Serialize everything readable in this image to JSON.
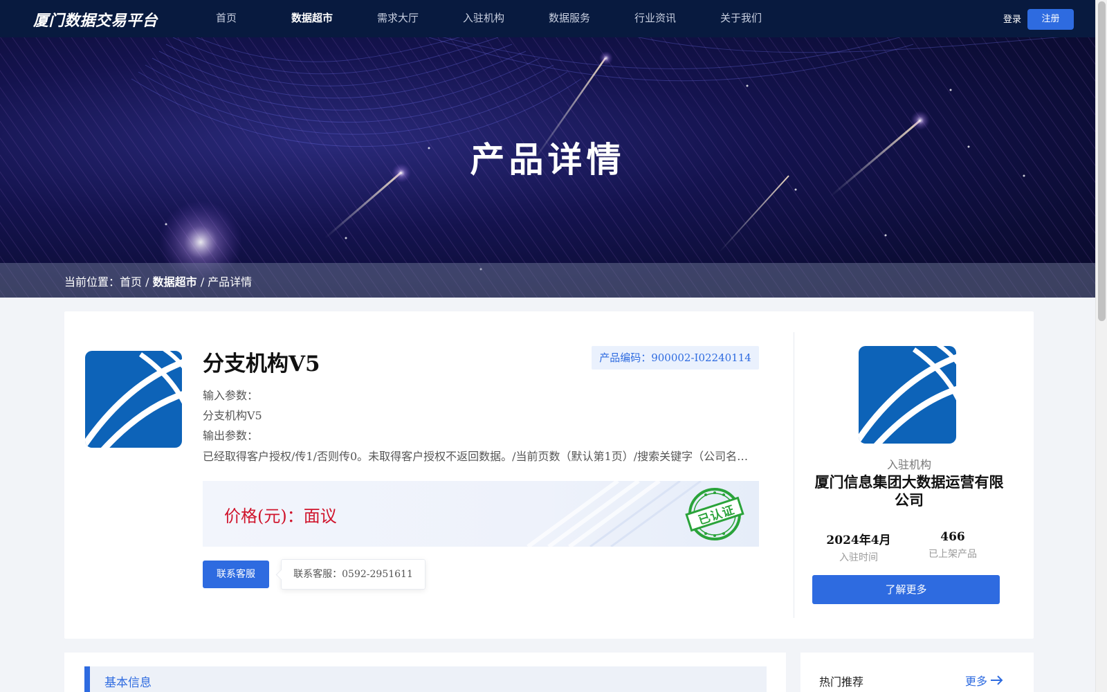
{
  "header": {
    "logo": "厦门数据交易平台",
    "nav": [
      "首页",
      "数据超市",
      "需求大厅",
      "入驻机构",
      "数据服务",
      "行业资讯",
      "关于我们"
    ],
    "active_index": 1,
    "login": "登录",
    "register": "注册"
  },
  "banner": {
    "title": "产品详情",
    "breadcrumb": {
      "prefix": "当前位置：",
      "home": "首页",
      "sep": " / ",
      "section": "数据超市",
      "current": "/ 产品详情"
    }
  },
  "product": {
    "title": "分支机构V5",
    "code": "产品编码：900002-I02240114",
    "input_label": "输入参数：",
    "input_value": "分支机构V5",
    "output_label": "输出参数：",
    "output_value": "已经取得客户授权/传1/否则传0。未取得客户授权不返回数据。/当前页数（默认第1页）/搜索关键字（公司名称、注册号、统一社会信用代码）",
    "price": "价格(元)：面议",
    "stamp": "已认证",
    "contact_button": "联系客服",
    "contact_tip": "联系客服：0592-2951611"
  },
  "org": {
    "label": "入驻机构",
    "name": "厦门信息集团大数据运营有限公司",
    "join_value": "2024年4月",
    "join_label": "入驻时间",
    "products_value": "466",
    "products_label": "已上架产品",
    "more_button": "了解更多"
  },
  "sections": {
    "basic_info": "基本信息",
    "hot": "热门推荐",
    "more": "更多"
  },
  "colors": {
    "primary": "#2e6be0",
    "header_bg": "#081a3f",
    "price": "#d0142c",
    "stamp": "#2aa33a",
    "logo_bg": "#0d63b8"
  }
}
